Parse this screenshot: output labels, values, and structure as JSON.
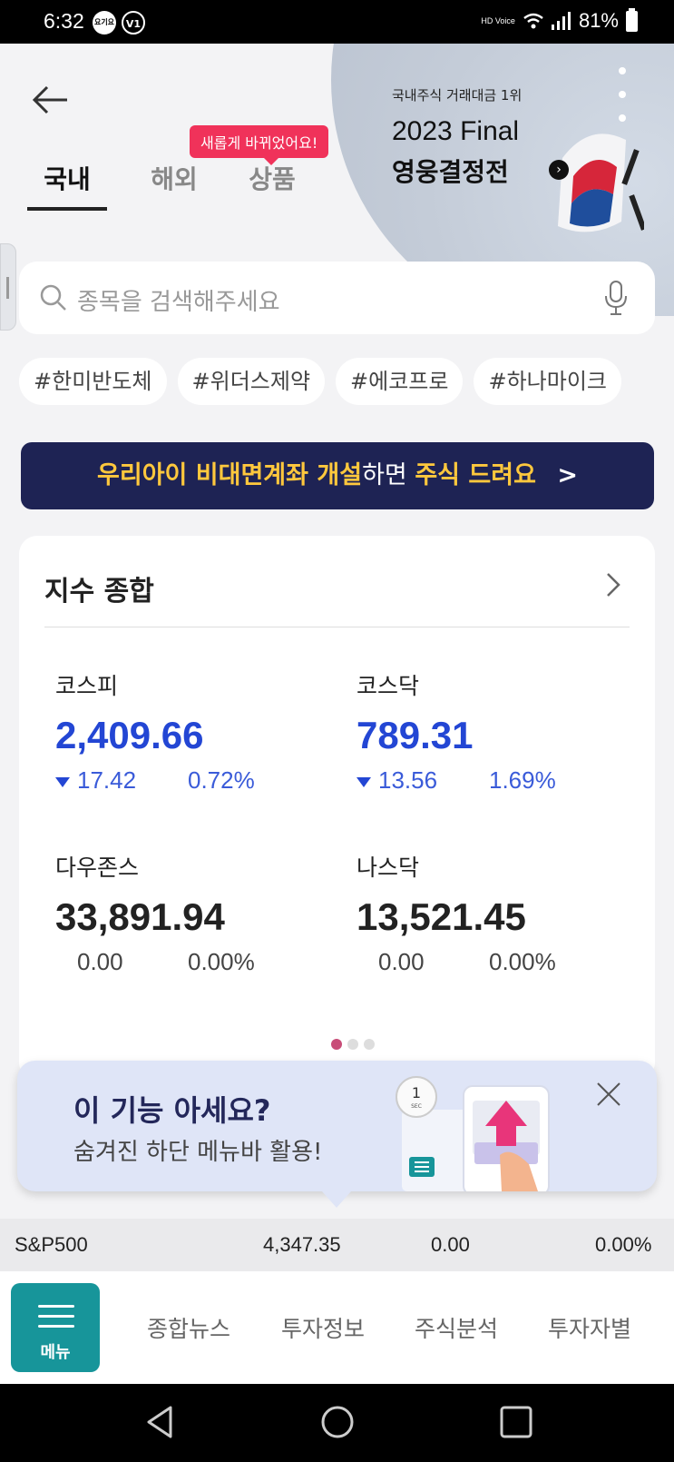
{
  "status_bar": {
    "time": "6:32",
    "left_badges": [
      "요기요",
      "V1"
    ],
    "hd_label": "HD Voice",
    "battery": "81%"
  },
  "header": {
    "tabs": [
      {
        "label": "국내",
        "active": true
      },
      {
        "label": "해외",
        "active": false
      },
      {
        "label": "상품",
        "active": false
      }
    ],
    "new_badge": "새롭게 바뀌었어요!",
    "banner": {
      "subtitle": "국내주식 거래대금 1위",
      "title_line1": "2023 Final",
      "title_line2": "영웅결정전"
    }
  },
  "search": {
    "placeholder": "종목을 검색해주세요"
  },
  "hashtags": [
    "#한미반도체",
    "#위더스제약",
    "#에코프로",
    "#하나마이크"
  ],
  "promo": {
    "part1": "우리아이 비대면계좌 개설",
    "part2": "하면 ",
    "part3": "주식 드려요",
    "arrow": ">"
  },
  "index_card": {
    "title": "지수 종합",
    "items": [
      {
        "name": "코스피",
        "value": "2,409.66",
        "change": "17.42",
        "percent": "0.72%",
        "direction": "down"
      },
      {
        "name": "코스닥",
        "value": "789.31",
        "change": "13.56",
        "percent": "1.69%",
        "direction": "down"
      },
      {
        "name": "다우존스",
        "value": "33,891.94",
        "change": "0.00",
        "percent": "0.00%",
        "direction": "flat"
      },
      {
        "name": "나스닥",
        "value": "13,521.45",
        "change": "0.00",
        "percent": "0.00%",
        "direction": "flat"
      }
    ],
    "page_count": 3,
    "current_page": 1
  },
  "tooltip": {
    "title": "이 기능 아세요?",
    "subtitle": "숨겨진 하단 메뉴바 활용!",
    "art_label": "1",
    "art_sec": "SEC"
  },
  "ticker": {
    "name": "S&P500",
    "value": "4,347.35",
    "change": "0.00",
    "percent": "0.00%"
  },
  "bottom_nav": {
    "menu_label": "메뉴",
    "items": [
      "종합뉴스",
      "투자정보",
      "주식분석",
      "투자자별"
    ]
  },
  "colors": {
    "accent_blue": "#2346d4",
    "promo_bg": "#1e2354",
    "promo_yellow": "#ffc83d",
    "badge_pink": "#f0325a",
    "menu_teal": "#17959a"
  }
}
